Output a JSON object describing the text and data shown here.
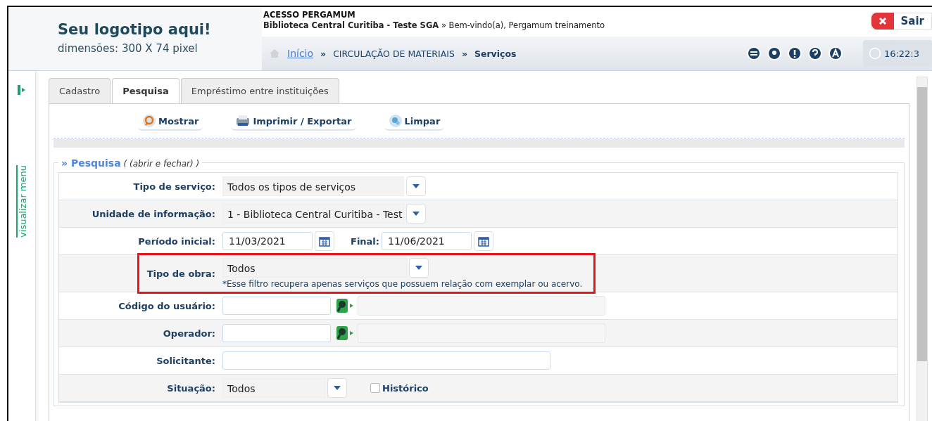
{
  "header": {
    "logo_title": "Seu logotipo aqui!",
    "logo_subtitle": "dimensões: 300 X 74 pixel",
    "system_name": "ACESSO PERGAMUM",
    "welcome": "**Biblioteca Central Curitiba - Teste SGA** » Bem-vindo(a), Pergamum treinamento",
    "logout": "Sair",
    "clock": "16:22:3",
    "breadcrumb": [
      {
        "label": "Início",
        "kind": "link"
      },
      {
        "label": "»",
        "kind": "sep"
      },
      {
        "label": "CIRCULAÇÃO DE MATERIAIS",
        "kind": "plain"
      },
      {
        "label": "»",
        "kind": "sep"
      },
      {
        "label": "Serviços",
        "kind": "current"
      }
    ]
  },
  "sidebar": {
    "label": "visualizar menu"
  },
  "tabs": [
    {
      "label": "Cadastro",
      "selected": false
    },
    {
      "label": "Pesquisa",
      "selected": true
    },
    {
      "label": "Empréstimo entre instituições",
      "selected": false
    }
  ],
  "toolbar": [
    {
      "label": "Mostrar",
      "kind": "show"
    },
    {
      "label": "Imprimir / Exportar",
      "kind": "print"
    },
    {
      "label": "Limpar",
      "kind": "clear"
    }
  ],
  "section": {
    "title": "» Pesquisa",
    "toggle": "( (abrir e fechar) )"
  },
  "rows": [
    {
      "label": "Tipo de serviço:",
      "kind": "select",
      "value": "Todos os tipos de serviços",
      "highlighted": false
    },
    {
      "label": "Unidade de informação:",
      "kind": "select",
      "value": "1 - Biblioteca Central Curitiba - Test",
      "highlighted": false
    },
    {
      "label": "Período inicial:",
      "kind": "date-range",
      "value": "11/03/2021",
      "label2": "Final:",
      "value2": "11/06/2021",
      "highlighted": false
    },
    {
      "label": "Tipo de obra:",
      "kind": "select-note",
      "value": "Todos",
      "note": "*Esse filtro recupera apenas serviços que possuem relação com exemplar ou acervo.",
      "highlighted": true
    },
    {
      "label": "Código do usuário:",
      "kind": "lookup",
      "highlighted": false
    },
    {
      "label": "Operador:",
      "kind": "lookup",
      "highlighted": false
    },
    {
      "label": "Solicitante:",
      "kind": "text",
      "highlighted": false
    },
    {
      "label": "Situação:",
      "kind": "select-check",
      "value": "Todos",
      "check_label": "Histórico",
      "checked": false,
      "highlighted": false
    }
  ]
}
